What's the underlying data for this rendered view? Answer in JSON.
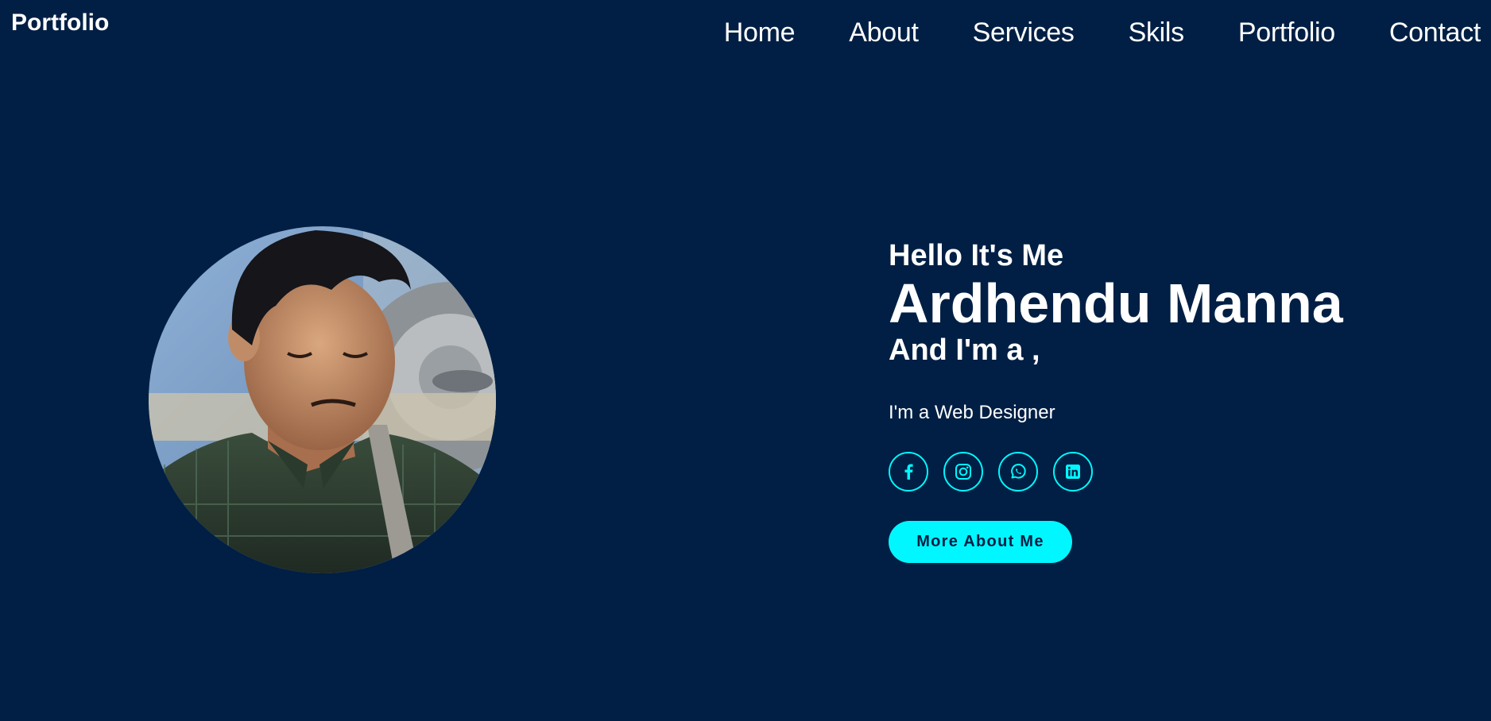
{
  "header": {
    "logo": "Portfolio",
    "nav": [
      {
        "label": "Home",
        "icon": ""
      },
      {
        "label": "About"
      },
      {
        "label": "Services"
      },
      {
        "label": "Skils"
      },
      {
        "label": "Portfolio"
      },
      {
        "label": "Contact"
      }
    ]
  },
  "hero": {
    "greeting": "Hello It's Me",
    "name": "Ardhendu Manna",
    "role_line": "And I'm a ,",
    "subtitle": "I'm a Web Designer",
    "socials": [
      "facebook-icon",
      "instagram-icon",
      "whatsapp-icon",
      "linkedin-icon"
    ],
    "cta_label": "More About Me"
  },
  "colors": {
    "background": "#011f44",
    "accent": "#00f7ff",
    "text": "#ffffff"
  }
}
